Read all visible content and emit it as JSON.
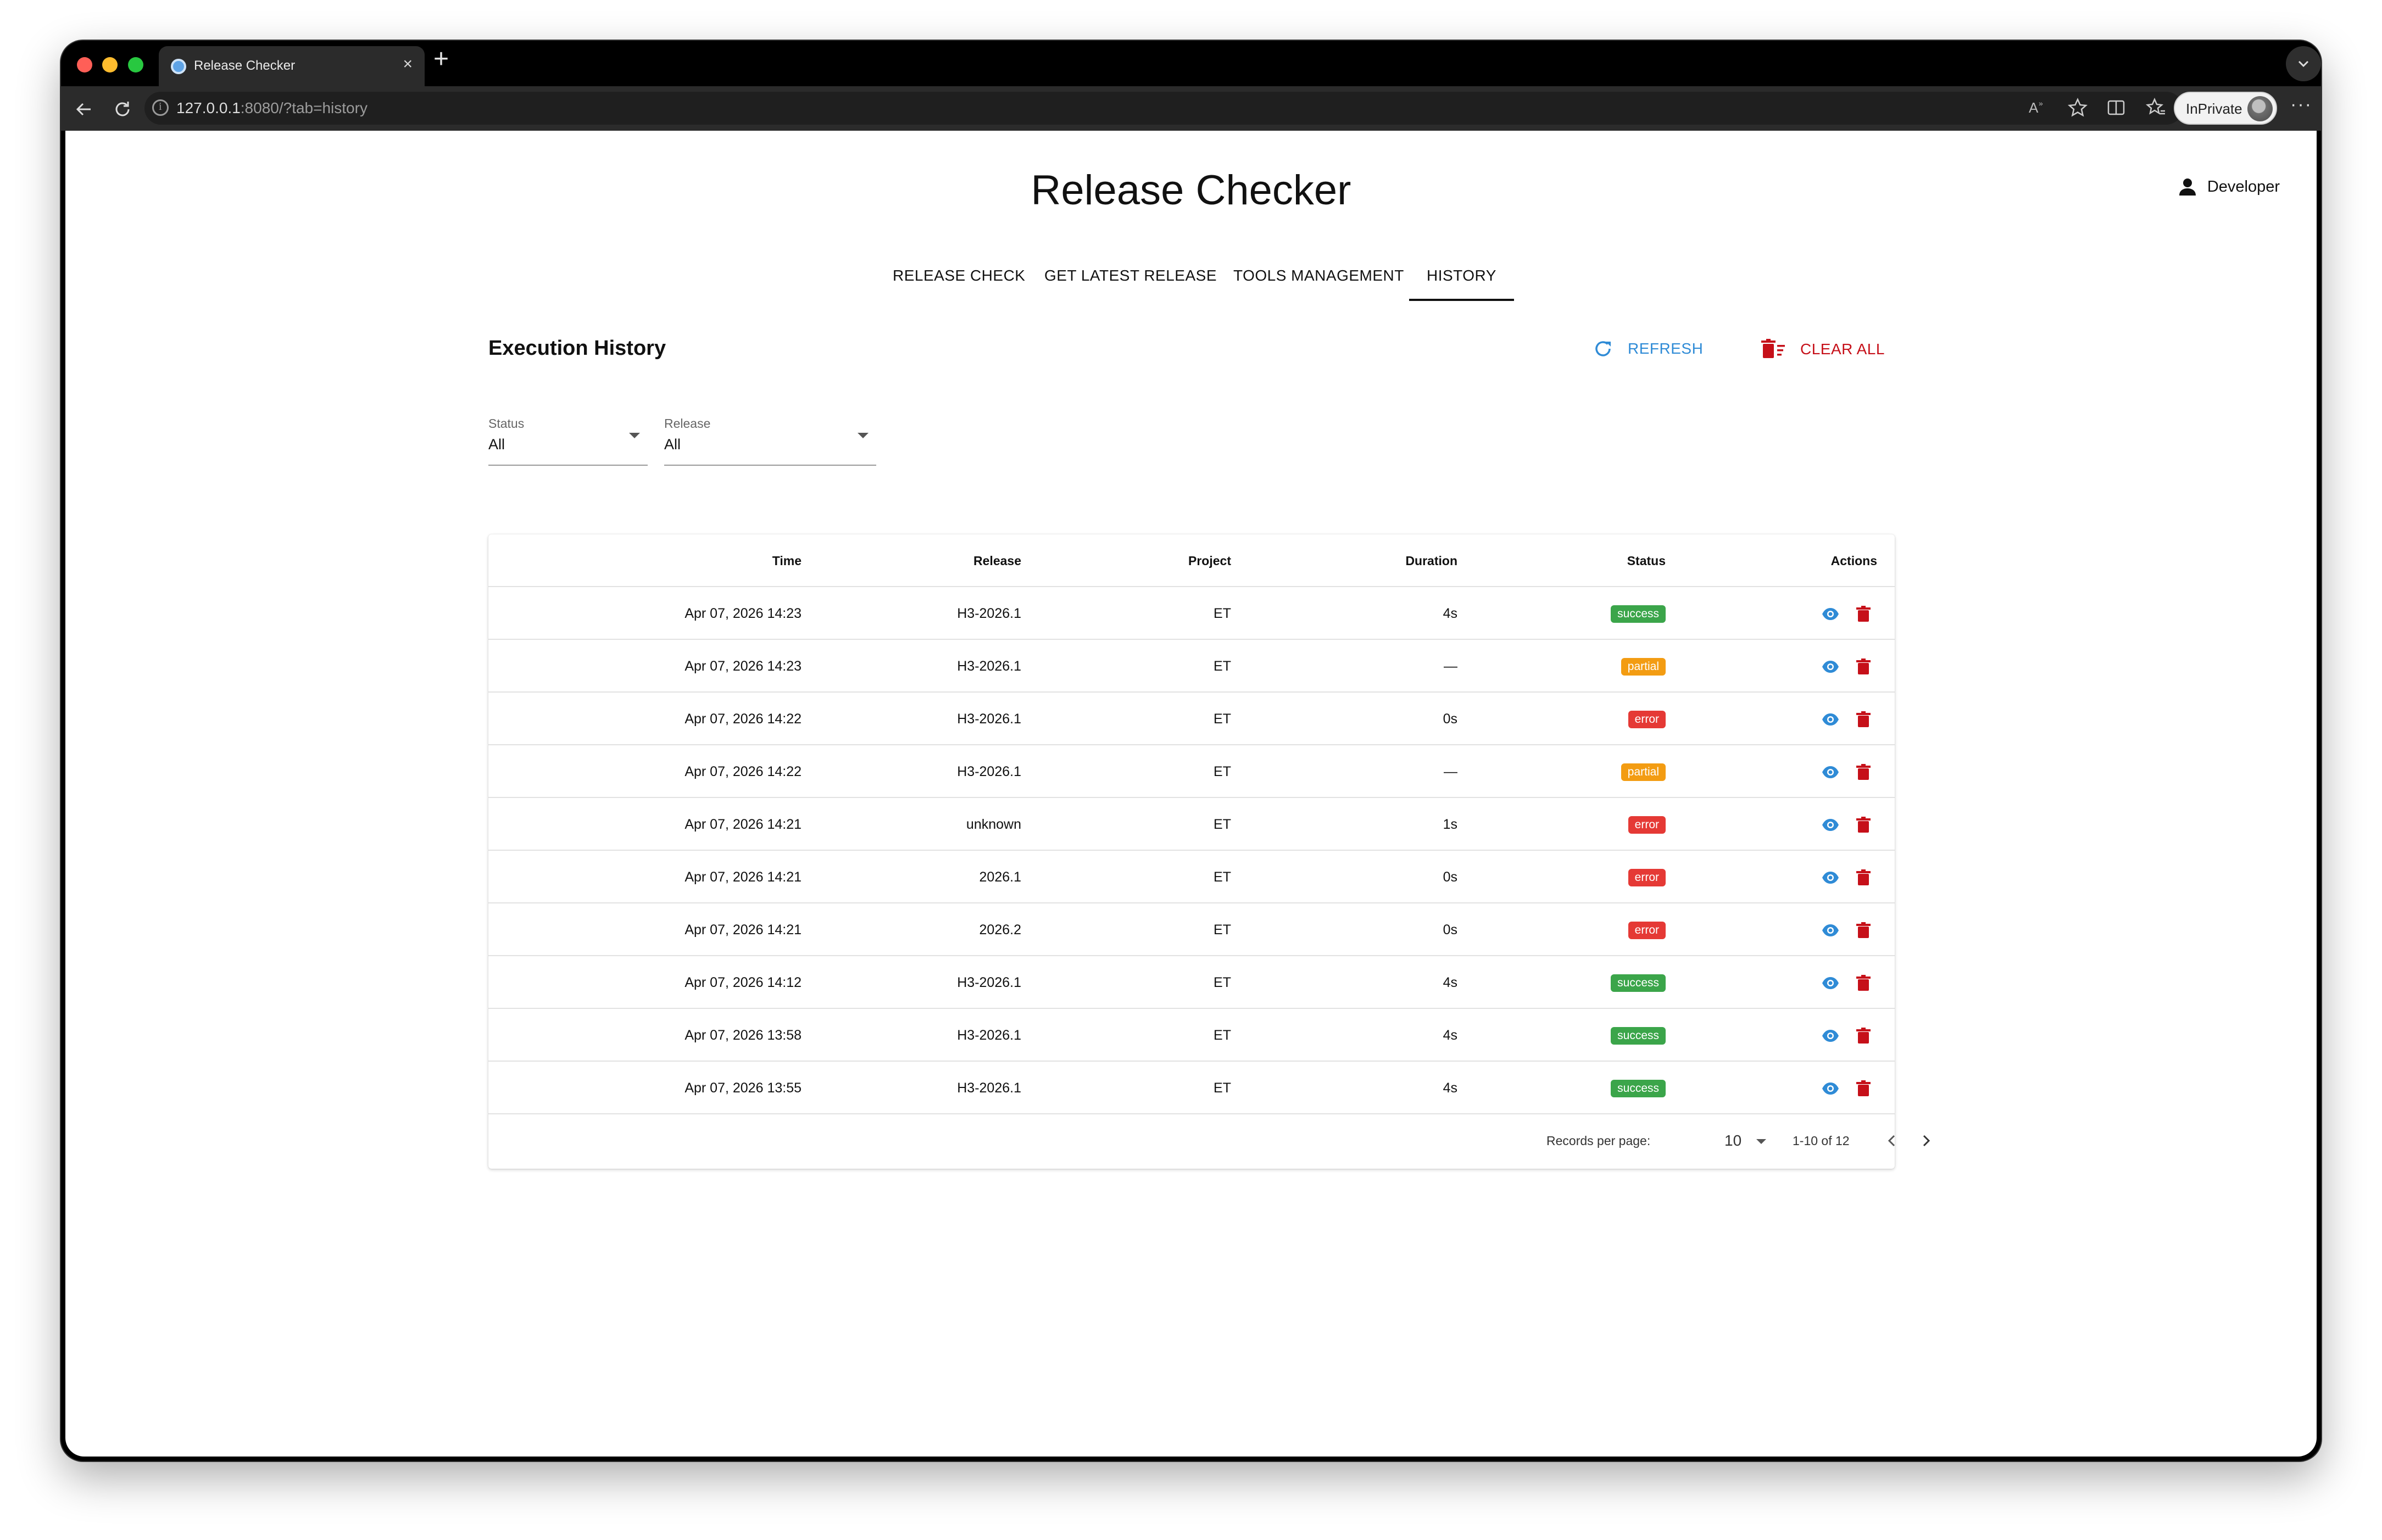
{
  "browser": {
    "tab_title": "Release Checker",
    "url_host": "127.0.0.1",
    "url_rest": ":8080/?tab=history",
    "inprivate_label": "InPrivate"
  },
  "app": {
    "title": "Release Checker",
    "user_name": "Developer",
    "tabs": [
      "RELEASE CHECK",
      "GET LATEST RELEASE",
      "TOOLS MANAGEMENT",
      "HISTORY"
    ],
    "active_tab": "HISTORY"
  },
  "history": {
    "title": "Execution History",
    "refresh_label": "REFRESH",
    "clear_label": "CLEAR ALL",
    "filters": {
      "status_label": "Status",
      "status_value": "All",
      "release_label": "Release",
      "release_value": "All"
    },
    "columns": [
      "Time",
      "Release",
      "Project",
      "Duration",
      "Status",
      "Actions"
    ],
    "rows": [
      {
        "time": "Apr 07, 2026 14:23",
        "release": "H3-2026.1",
        "project": "ET",
        "duration": "4s",
        "status": "success"
      },
      {
        "time": "Apr 07, 2026 14:23",
        "release": "H3-2026.1",
        "project": "ET",
        "duration": "—",
        "status": "partial"
      },
      {
        "time": "Apr 07, 2026 14:22",
        "release": "H3-2026.1",
        "project": "ET",
        "duration": "0s",
        "status": "error"
      },
      {
        "time": "Apr 07, 2026 14:22",
        "release": "H3-2026.1",
        "project": "ET",
        "duration": "—",
        "status": "partial"
      },
      {
        "time": "Apr 07, 2026 14:21",
        "release": "unknown",
        "project": "ET",
        "duration": "1s",
        "status": "error"
      },
      {
        "time": "Apr 07, 2026 14:21",
        "release": "2026.1",
        "project": "ET",
        "duration": "0s",
        "status": "error"
      },
      {
        "time": "Apr 07, 2026 14:21",
        "release": "2026.2",
        "project": "ET",
        "duration": "0s",
        "status": "error"
      },
      {
        "time": "Apr 07, 2026 14:12",
        "release": "H3-2026.1",
        "project": "ET",
        "duration": "4s",
        "status": "success"
      },
      {
        "time": "Apr 07, 2026 13:58",
        "release": "H3-2026.1",
        "project": "ET",
        "duration": "4s",
        "status": "success"
      },
      {
        "time": "Apr 07, 2026 13:55",
        "release": "H3-2026.1",
        "project": "ET",
        "duration": "4s",
        "status": "success"
      }
    ],
    "pagination": {
      "records_label": "Records per page:",
      "per_page": "10",
      "range": "1-10 of 12"
    }
  },
  "colors": {
    "success": "#3ba54a",
    "partial": "#f39c12",
    "error": "#e53935",
    "refresh": "#2f8bd6",
    "danger": "#c61019"
  },
  "icons": {
    "back": "arrow-left-icon",
    "reload": "reload-icon",
    "read_aloud": "read-aloud-icon",
    "favorite": "star-icon",
    "split": "split-screen-icon",
    "favorites_bar": "favorites-icon",
    "user": "person-icon",
    "refresh": "refresh-icon",
    "clear": "delete-sweep-icon",
    "view": "eye-icon",
    "delete": "trash-icon",
    "prev": "chevron-left-icon",
    "next": "chevron-right-icon"
  }
}
